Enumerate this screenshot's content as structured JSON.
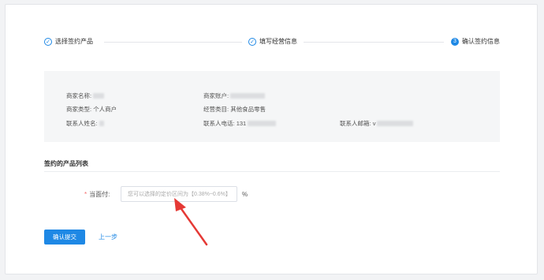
{
  "steps": [
    {
      "index": "✓",
      "label": "选择签约产品",
      "status": "done"
    },
    {
      "index": "✓",
      "label": "填写经营信息",
      "status": "done"
    },
    {
      "index": "3",
      "label": "确认签约信息",
      "status": "active"
    }
  ],
  "info": {
    "merchant_name_label": "商家名称:",
    "merchant_account_label": "商家账户:",
    "merchant_type_label": "商家类型:",
    "merchant_type_value": "个人商户",
    "business_category_label": "经营类目:",
    "business_category_value": "其他食品零售",
    "contact_name_label": "联系人姓名:",
    "contact_phone_label": "联系人电话:",
    "contact_phone_value": "131",
    "contact_email_label": "联系人邮箱:",
    "contact_email_value": "v"
  },
  "products": {
    "section_title": "签约的产品列表",
    "rate_label": "当面付:",
    "required_mark": "*",
    "rate_placeholder": "您可以选择的定价区间为【0.38%~0.6%】",
    "rate_unit": "%"
  },
  "actions": {
    "submit_label": "确认提交",
    "back_label": "上一步"
  },
  "colors": {
    "accent": "#1e88e5",
    "annotation_arrow": "#e53935"
  }
}
